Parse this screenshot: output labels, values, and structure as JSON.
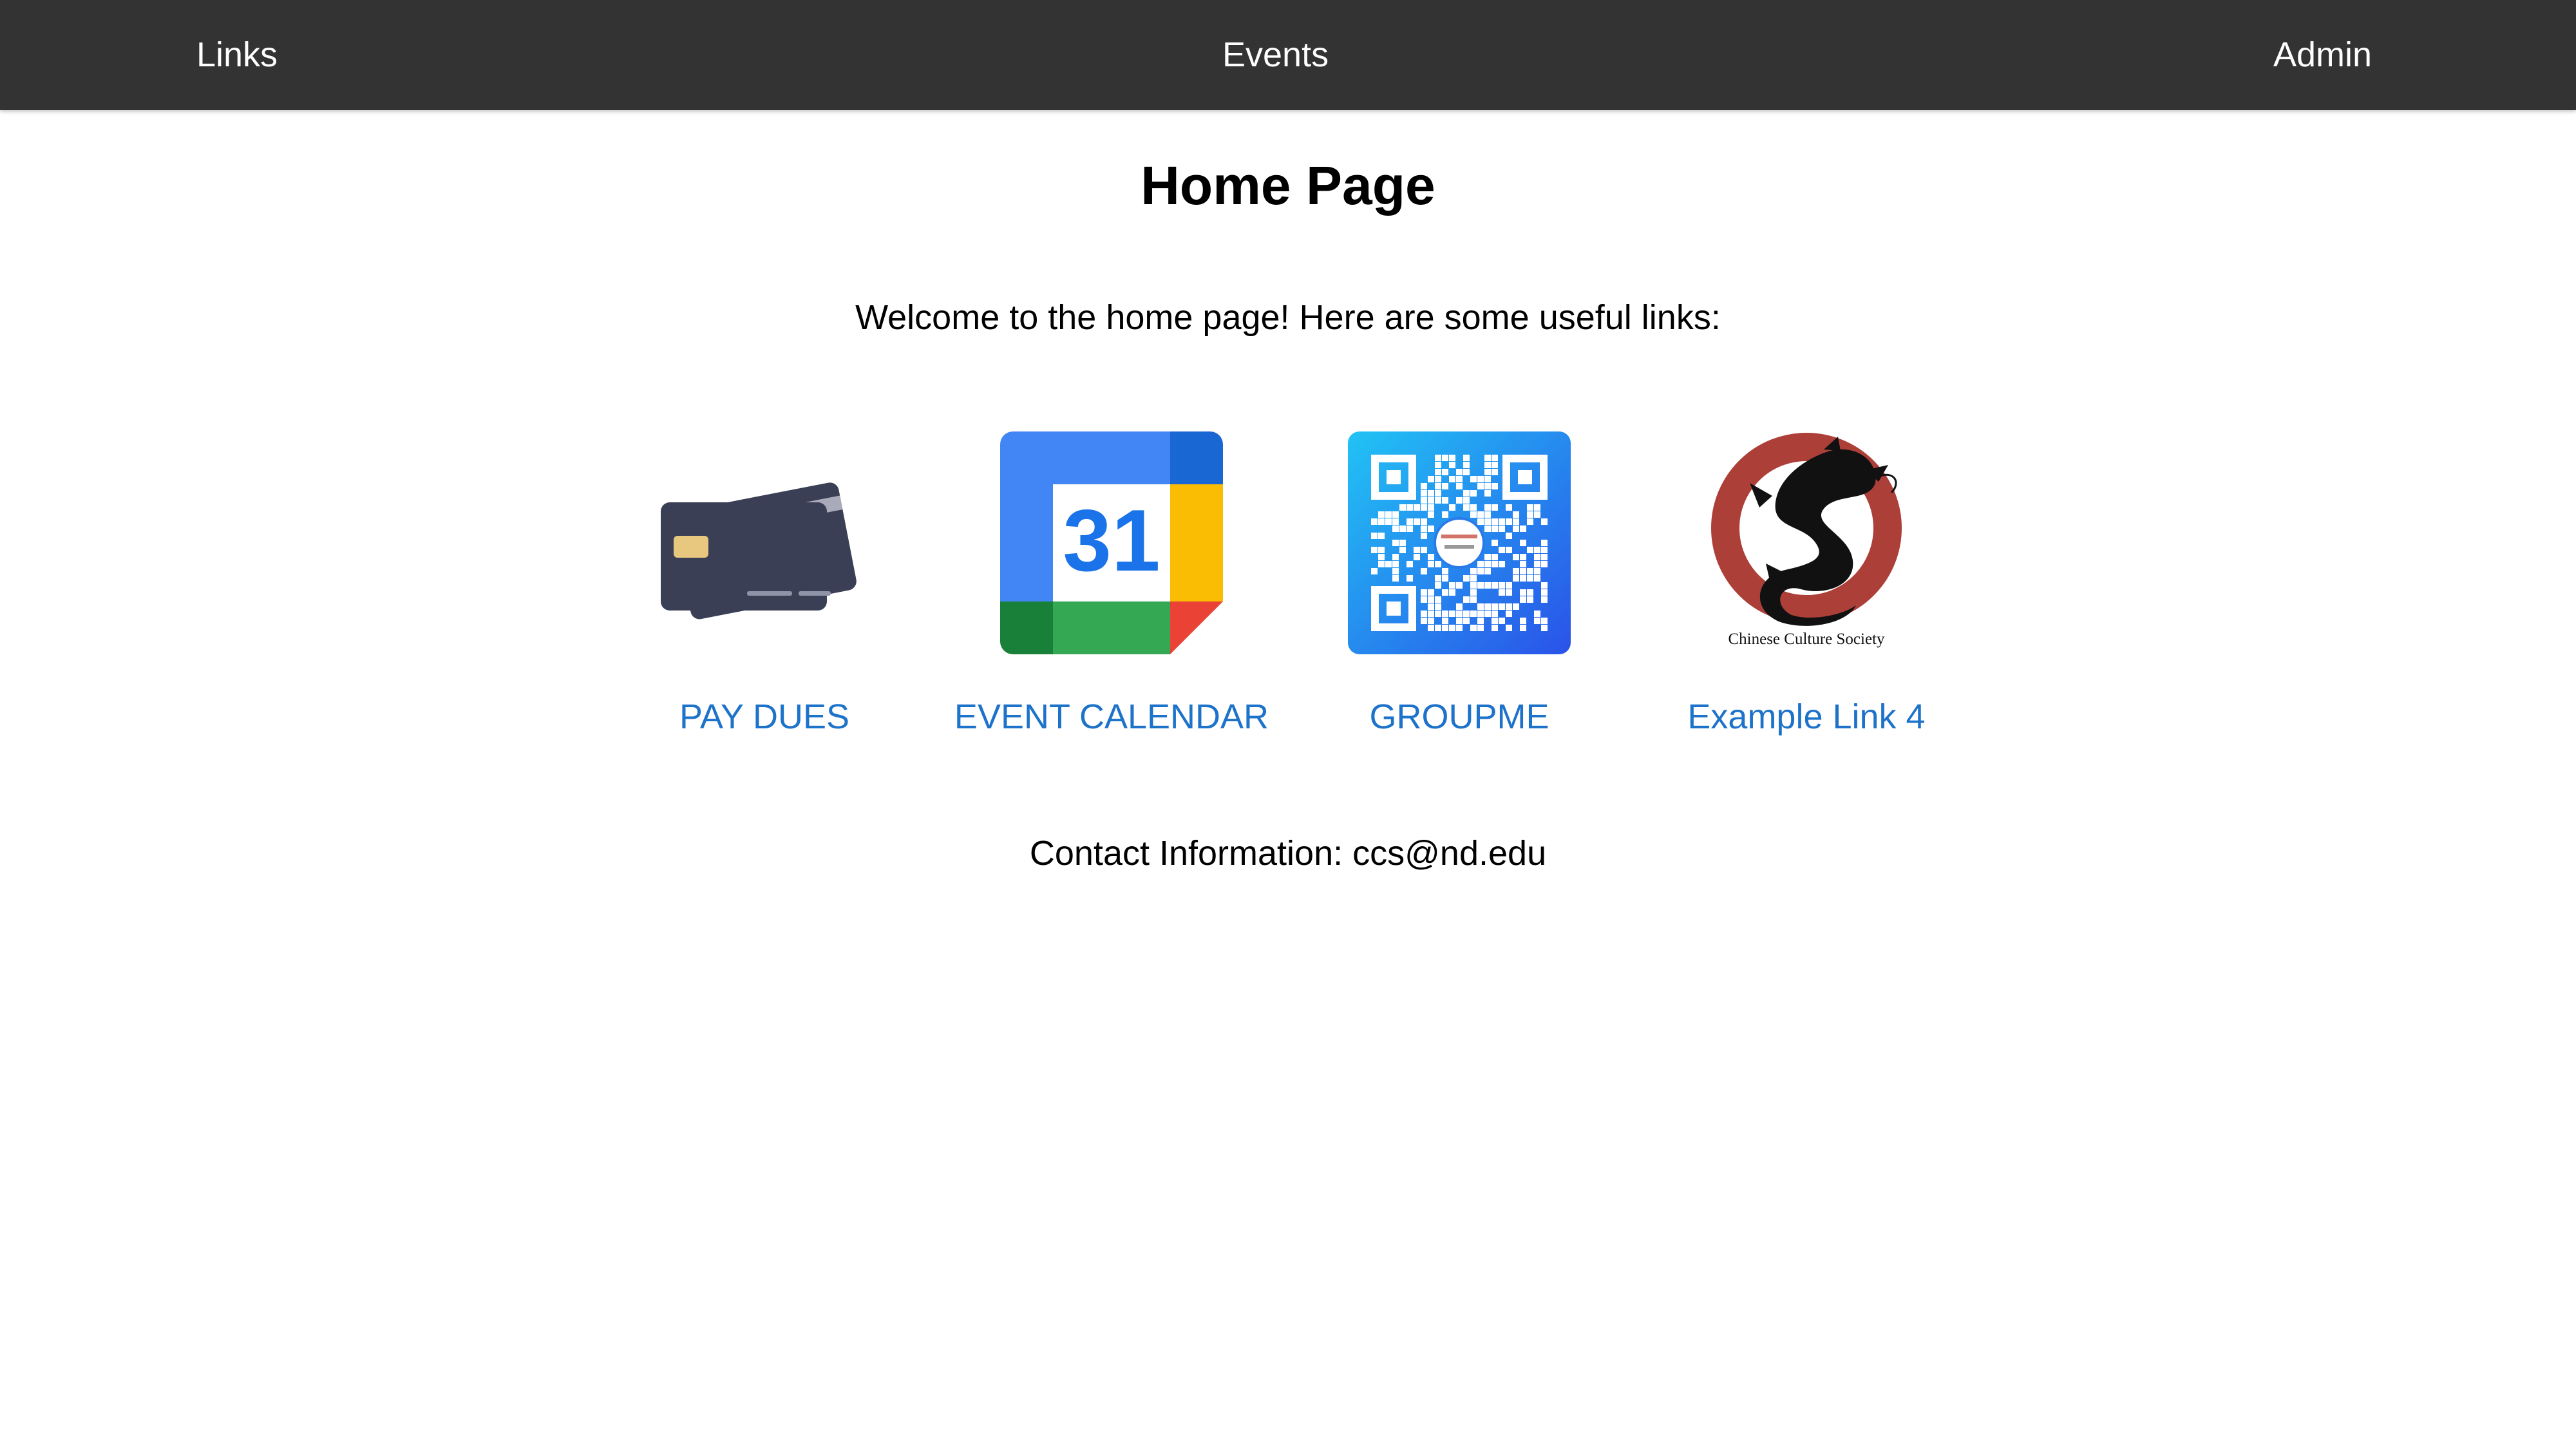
{
  "nav": {
    "links_label": "Links",
    "events_label": "Events",
    "admin_label": "Admin"
  },
  "main": {
    "title": "Home Page",
    "welcome": "Welcome to the home page! Here are some useful links:",
    "contact": "Contact Information: ccs@nd.edu"
  },
  "links": [
    {
      "label": "PAY DUES",
      "icon": "credit-card-icon"
    },
    {
      "label": "EVENT CALENDAR",
      "icon": "calendar-icon",
      "icon_text": "31"
    },
    {
      "label": "GROUPME",
      "icon": "qr-code-icon"
    },
    {
      "label": "Example Link 4",
      "icon": "dragon-logo-icon",
      "icon_text": "Chinese Culture Society"
    }
  ],
  "colors": {
    "navbar": "#333333",
    "link": "#1d72c9",
    "card": "#3a3f55",
    "chip": "#e8c77f"
  }
}
